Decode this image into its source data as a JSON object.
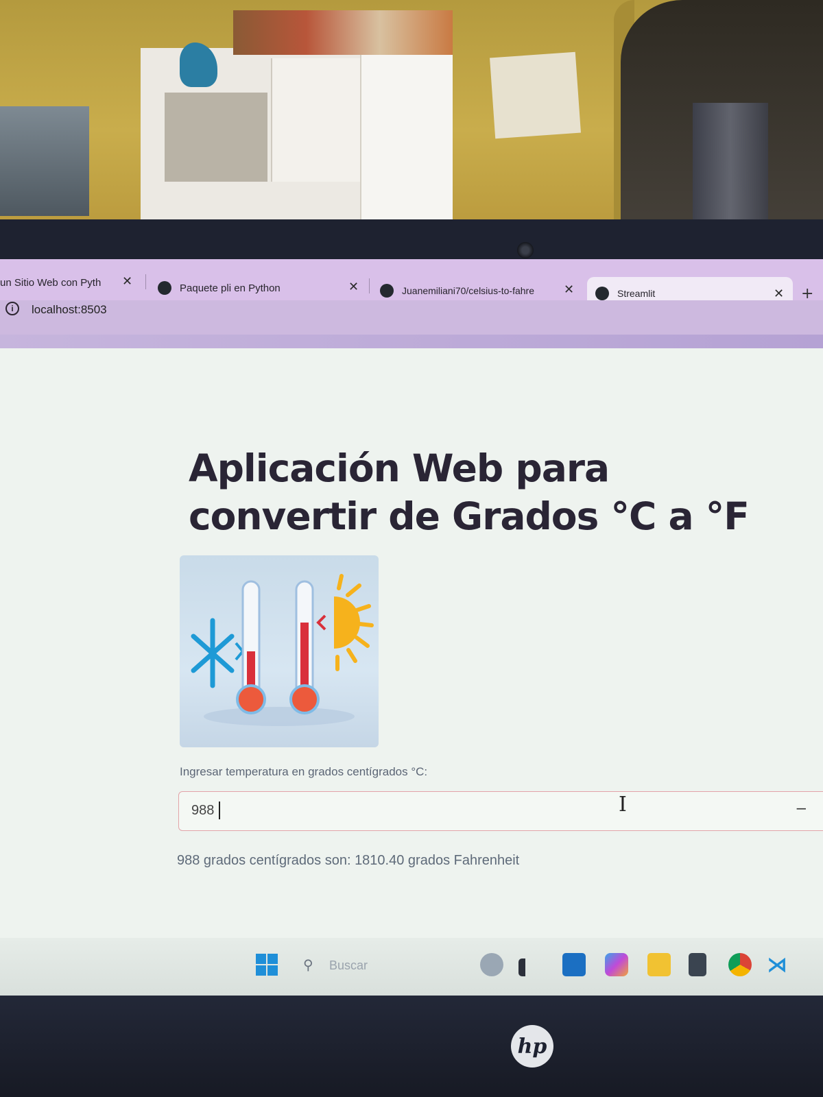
{
  "tabs": [
    {
      "label": "un Sitio Web con Pyth",
      "close": "✕"
    },
    {
      "label": "Paquete pli en Python",
      "close": "✕"
    },
    {
      "label": "Juanemiliani70/celsius-to-fahre",
      "close": "✕"
    },
    {
      "label": "Streamlit",
      "close": "✕",
      "active": true
    }
  ],
  "new_tab": "+",
  "address": {
    "info_glyph": "i",
    "url": "localhost:8503"
  },
  "app": {
    "title": "Aplicación Web para convertir de Grados °C a °F",
    "input_label": "Ingresar temperatura en grados centígrados °C:",
    "input_value": "988",
    "stepper_minus": "–",
    "result": "988 grados centígrados son: 1810.40 grados Fahrenheit"
  },
  "taskbar": {
    "search_placeholder": "Buscar",
    "icons": [
      "windows-start-icon",
      "copilot-icon",
      "widgets-icon",
      "store-icon",
      "app-icon",
      "file-explorer-icon",
      "calculator-icon",
      "chrome-icon",
      "vscode-icon"
    ]
  },
  "colors": {
    "accent_input_border": "#e2a3a8",
    "tab_strip": "#d9c0e9",
    "title_text": "#2a2535"
  },
  "bezel_brand": "hp"
}
